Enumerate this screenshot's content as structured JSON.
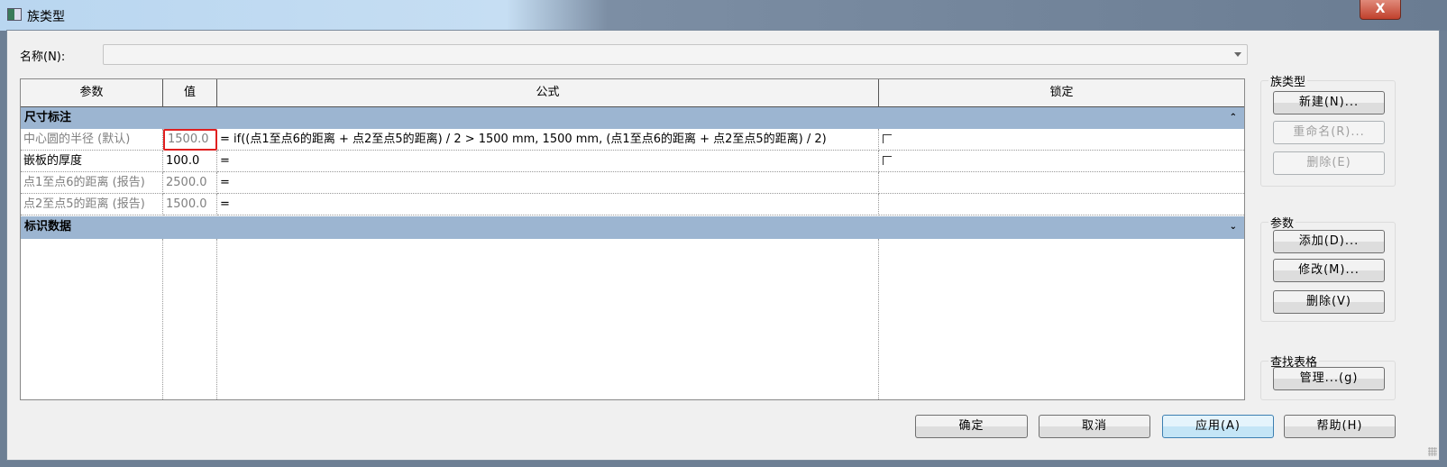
{
  "window": {
    "title": "族类型",
    "close_label": "X"
  },
  "name_field": {
    "label": "名称(N):",
    "value": ""
  },
  "table": {
    "headers": [
      "参数",
      "值",
      "公式",
      "锁定"
    ],
    "groups": [
      {
        "label": "尺寸标注",
        "collapse_icon": "chevron-double-up",
        "rows": [
          {
            "param": "中心圆的半径 (默认)",
            "value": "1500.0",
            "formula": "= if((点1至点6的距离 + 点2至点5的距离) / 2 > 1500 mm, 1500 mm, (点1至点6的距离 + 点2至点5的距离) / 2)",
            "lock": false,
            "readonly": true,
            "selected": true
          },
          {
            "param": "嵌板的厚度",
            "value": "100.0",
            "formula": "=",
            "lock": false,
            "readonly": false
          },
          {
            "param": "点1至点6的距离 (报告)",
            "value": "2500.0",
            "formula": "=",
            "readonly": true
          },
          {
            "param": "点2至点5的距离 (报告)",
            "value": "1500.0",
            "formula": "=",
            "readonly": true
          }
        ]
      },
      {
        "label": "标识数据",
        "collapse_icon": "chevron-double-down",
        "rows": []
      }
    ]
  },
  "family_types": {
    "title": "族类型",
    "new": "新建(N)...",
    "rename": "重命名(R)...",
    "delete": "删除(E)"
  },
  "parameters": {
    "title": "参数",
    "add": "添加(D)...",
    "modify": "修改(M)...",
    "delete": "删除(V)"
  },
  "lookup": {
    "title": "查找表格",
    "manage": "管理...(g)"
  },
  "footer": {
    "ok": "确定",
    "cancel": "取消",
    "apply": "应用(A)",
    "help": "帮助(H)"
  },
  "colors": {
    "group_header": "#9cb5d1",
    "selected_border": "#e02020"
  }
}
